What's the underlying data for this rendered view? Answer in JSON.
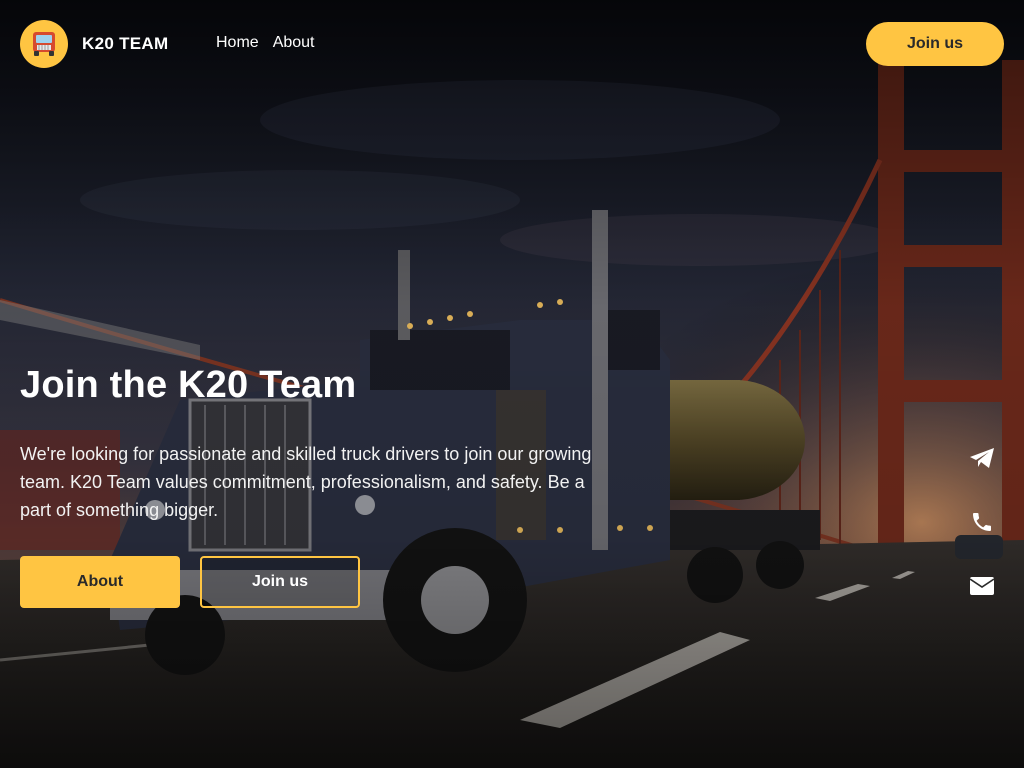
{
  "brand": {
    "name": "K20 TEAM",
    "logo_icon": "truck-icon",
    "accent": "#ffc542"
  },
  "nav": {
    "items": [
      {
        "label": "Home"
      },
      {
        "label": "About"
      }
    ],
    "join_label": "Join us"
  },
  "hero": {
    "title": "Join the K20 Team",
    "text": "We're looking for passionate and skilled truck drivers to join our growing team. K20 Team values commitment, professionalism, and safety. Be a part of something bigger.",
    "primary_cta": "About",
    "secondary_cta": "Join us"
  },
  "social": [
    {
      "icon": "telegram-icon"
    },
    {
      "icon": "phone-icon"
    },
    {
      "icon": "mail-icon"
    }
  ]
}
